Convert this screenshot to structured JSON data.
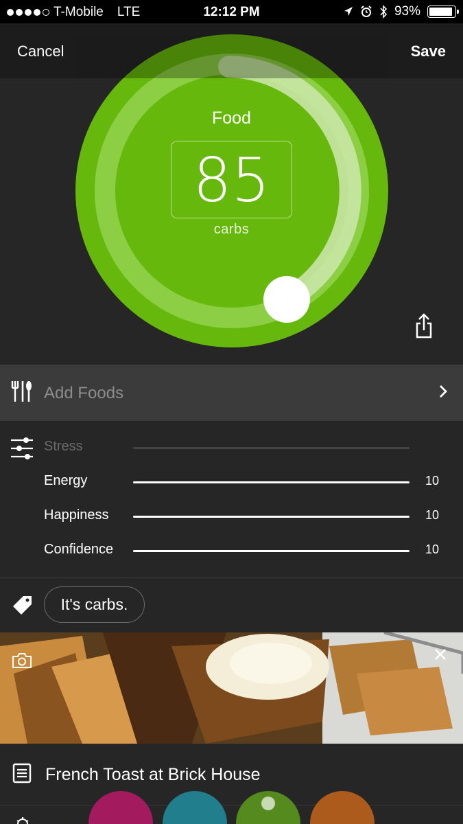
{
  "status_bar": {
    "carrier": "T-Mobile",
    "network": "LTE",
    "time": "12:12 PM",
    "battery_percent": "93%",
    "icons": [
      "location-arrow-icon",
      "alarm-icon",
      "bluetooth-icon",
      "battery-icon"
    ]
  },
  "nav": {
    "cancel_label": "Cancel",
    "save_label": "Save"
  },
  "dial": {
    "title": "Food",
    "value": "85",
    "unit": "carbs",
    "level_fraction": 0.6,
    "colors": {
      "outer": "#66b80c",
      "ring": "#8ccf44",
      "arc": "#c8e6a6"
    }
  },
  "add_foods": {
    "label": "Add Foods"
  },
  "sliders": [
    {
      "name": "Stress",
      "value": ""
    },
    {
      "name": "Energy",
      "value": "10"
    },
    {
      "name": "Happiness",
      "value": "10"
    },
    {
      "name": "Confidence",
      "value": "10"
    }
  ],
  "tag": {
    "label": "It's carbs."
  },
  "note": {
    "text": "French Toast at Brick House"
  },
  "color_buttons": [
    "#a41a5e",
    "#217e8c",
    "#558a1f",
    "#ad5b1d"
  ]
}
